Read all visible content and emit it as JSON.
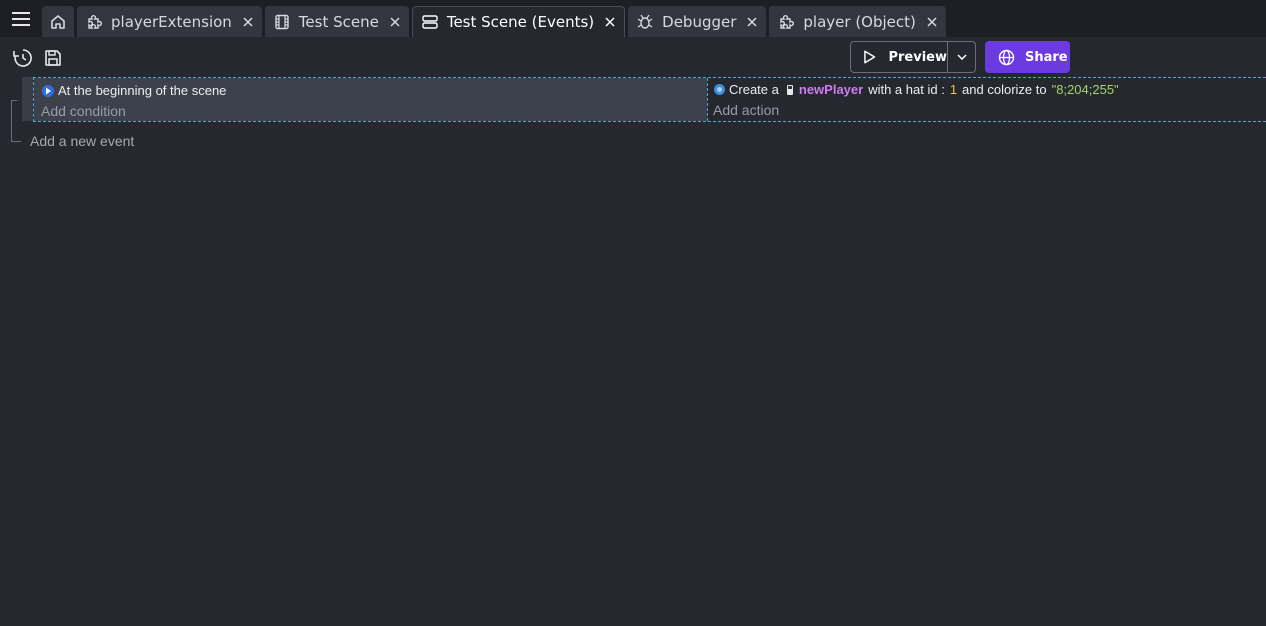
{
  "tabs": [
    {
      "label": "playerExtension",
      "icon": "puzzle-icon",
      "active": false
    },
    {
      "label": "Test Scene",
      "icon": "film-icon",
      "active": false
    },
    {
      "label": "Test Scene (Events)",
      "icon": "events-list-icon",
      "active": true
    },
    {
      "label": "Debugger",
      "icon": "bug-icon",
      "active": false
    },
    {
      "label": "player (Object)",
      "icon": "puzzle-icon",
      "active": false
    }
  ],
  "toolbar": {
    "preview_label": "Preview",
    "share_label": "Share"
  },
  "colors": {
    "accent": "#6b3be0",
    "selection_border": "#4fa8c9",
    "object_name": "#d07bf0",
    "number_param": "#f0c34a",
    "string_param": "#a6d36a"
  },
  "event": {
    "condition_text": "At the beginning of the scene",
    "add_condition": "Add condition",
    "action": {
      "prefix": "Create a",
      "object_name": "newPlayer",
      "mid": "with a hat id :",
      "hat_id": "1",
      "suffix": "and colorize to",
      "color_value": "\"8;204;255\""
    },
    "add_action": "Add action"
  },
  "add_event": "Add a new event"
}
